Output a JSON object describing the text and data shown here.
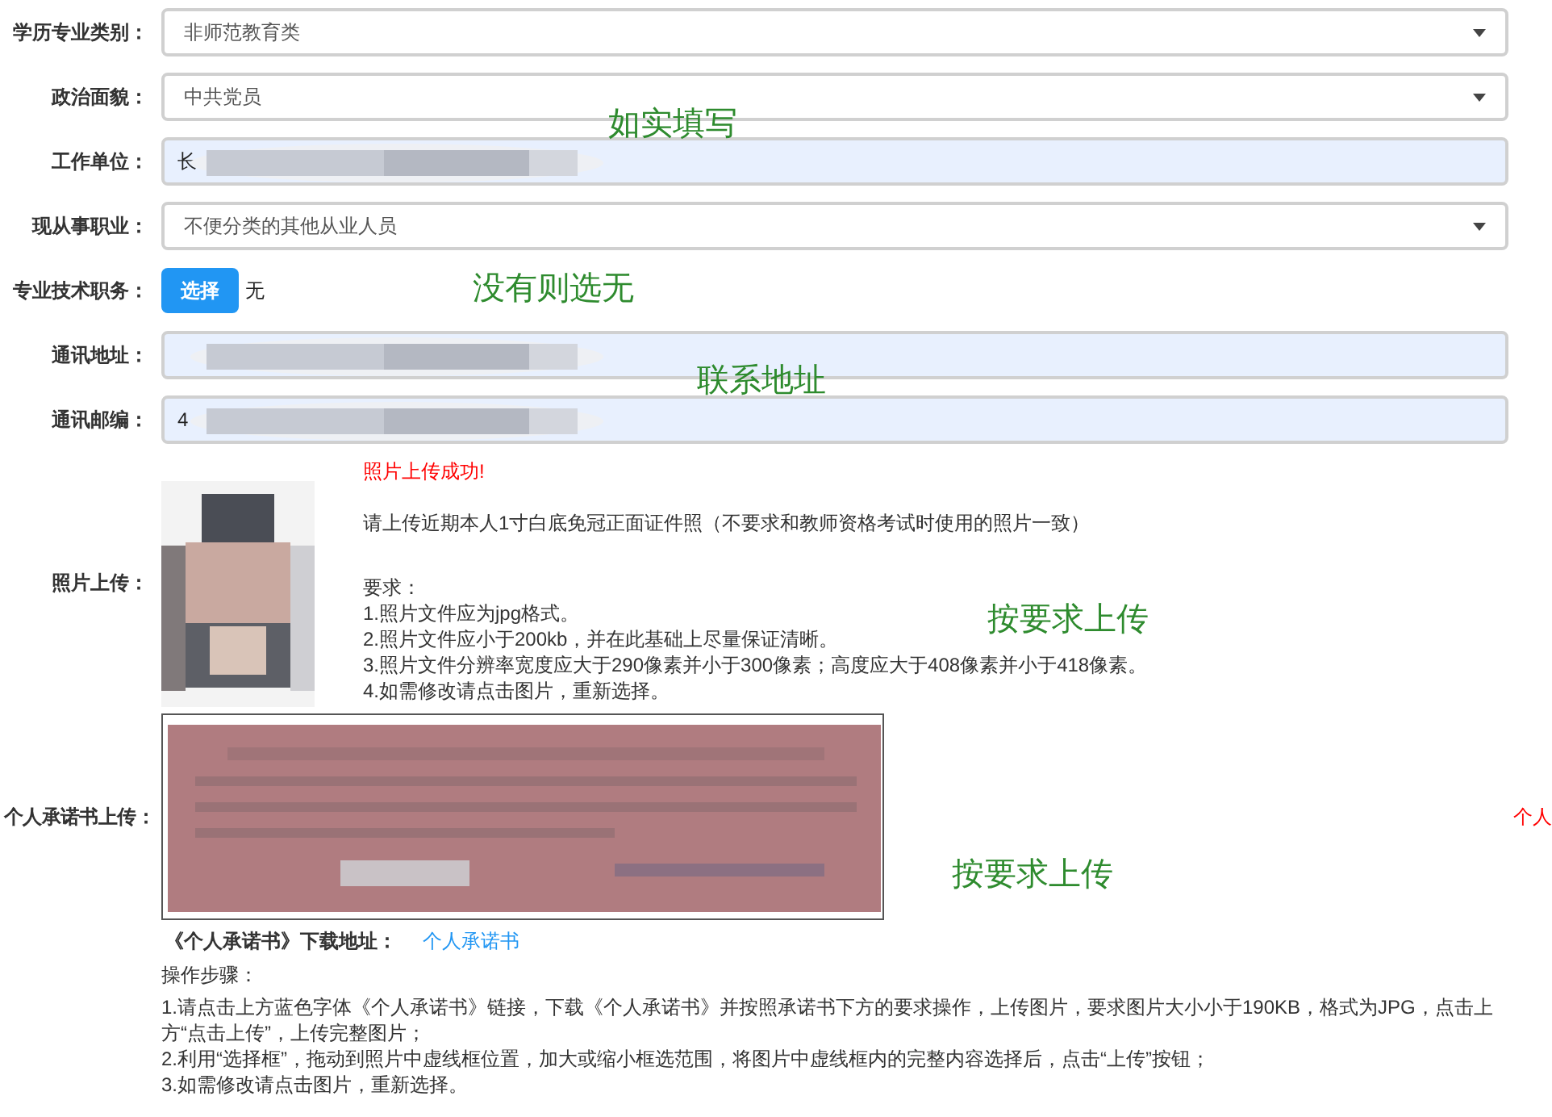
{
  "fields": [
    {
      "label": "学历专业类别：",
      "kind": "select",
      "value": "非师范教育类"
    },
    {
      "label": "政治面貌：",
      "kind": "select",
      "value": "中共党员"
    },
    {
      "label": "工作单位：",
      "kind": "input",
      "value": "长"
    },
    {
      "label": "现从事职业：",
      "kind": "select",
      "value": "不便分类的其他从业人员"
    },
    {
      "label": "专业技术职务：",
      "kind": "choose",
      "button": "选择",
      "value": "无"
    },
    {
      "label": "通讯地址：",
      "kind": "input"
    },
    {
      "label": "通讯邮编：",
      "kind": "input",
      "value": "4"
    }
  ],
  "photo": {
    "label": "照片上传：",
    "status": "照片上传成功!",
    "note": "请上传近期本人1寸白底免冠正面证件照（不要求和教师资格考试时使用的照片一致）",
    "requirements_title": "要求：",
    "requirements": [
      "1.照片文件应为jpg格式。",
      "2.照片文件应小于200kb，并在此基础上尽量保证清晰。",
      "3.照片文件分辨率宽度应大于290像素并小于300像素；高度应大于408像素并小于418像素。",
      "4.如需修改请点击图片，重新选择。"
    ]
  },
  "pledge": {
    "label": "个人承诺书上传：",
    "side_note": "个人",
    "download_label": "《个人承诺书》下载地址：",
    "download_link": "个人承诺书",
    "steps_title": "操作步骤：",
    "steps": [
      "1.请点击上方蓝色字体《个人承诺书》链接，下载《个人承诺书》并按照承诺书下方的要求操作，上传图片，要求图片大小小于190KB，格式为JPG，点击上方“点击上传”，上传完整图片；",
      "2.利用“选择框”，拖动到照片中虚线框位置，加大或缩小框选范围，将图片中虚线框内的完整内容选择后，点击“上传”按钮；",
      "3.如需修改请点击图片，重新选择。"
    ]
  },
  "annotations": [
    "如实填写",
    "没有则选无",
    "联系地址",
    "按要求上传",
    "按要求上传"
  ]
}
